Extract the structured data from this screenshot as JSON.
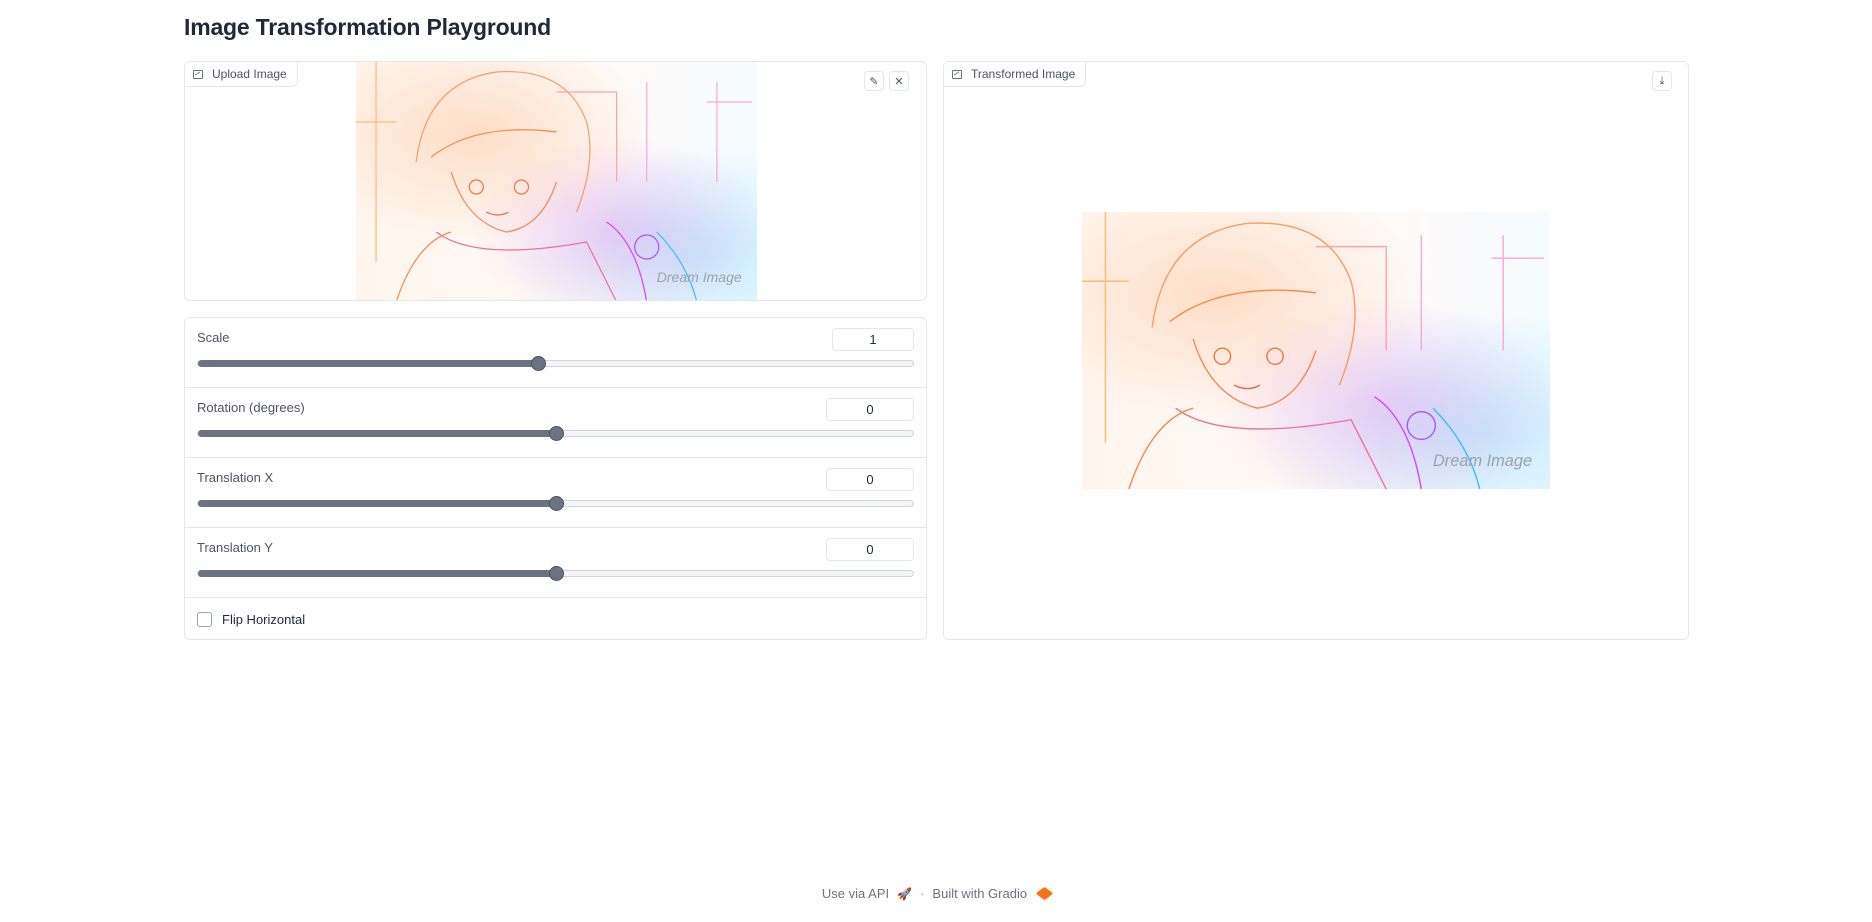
{
  "page": {
    "title": "Image Transformation Playground"
  },
  "input_image": {
    "label": "Upload Image",
    "edit_icon": "pencil-icon",
    "clear_icon": "close-icon"
  },
  "output_image": {
    "label": "Transformed Image",
    "download_icon": "download-icon"
  },
  "sliders": [
    {
      "label": "Scale",
      "value": "1",
      "fraction": 0.475
    },
    {
      "label": "Rotation (degrees)",
      "value": "0",
      "fraction": 0.5
    },
    {
      "label": "Translation X",
      "value": "0",
      "fraction": 0.5
    },
    {
      "label": "Translation Y",
      "value": "0",
      "fraction": 0.5
    }
  ],
  "checkbox": {
    "label": "Flip Horizontal",
    "checked": false
  },
  "footer": {
    "api_label": "Use via API",
    "separator": "·",
    "built_label": "Built with Gradio"
  },
  "colors": {
    "accent": "#f97316",
    "slider_fill": "#6b7280",
    "border": "#e5e7eb"
  }
}
